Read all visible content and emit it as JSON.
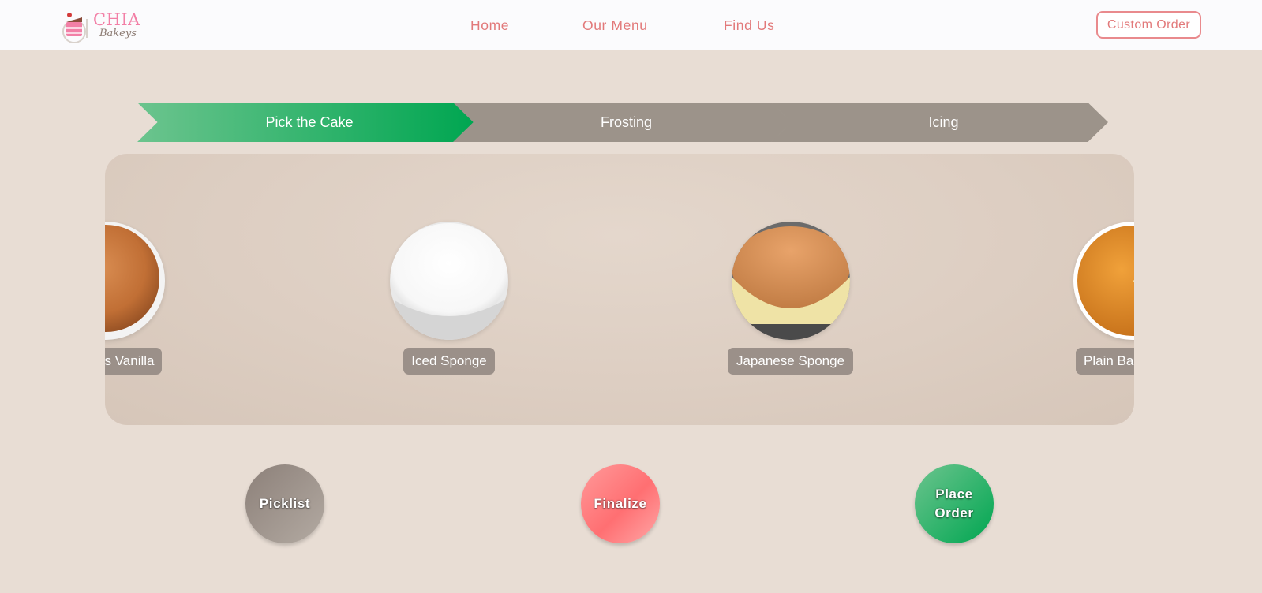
{
  "brand": {
    "name": "CHIA",
    "tagline": "Bakeys"
  },
  "nav": {
    "home": "Home",
    "menu": "Our Menu",
    "find_us": "Find Us"
  },
  "custom_order": "Custom Order",
  "steps": [
    "Pick the Cake",
    "Frosting",
    "Icing"
  ],
  "cakes": [
    "s Vanilla",
    "Iced Sponge",
    "Japanese Sponge",
    "Plain Ba"
  ],
  "actions": {
    "picklist": "Picklist",
    "finalize": "Finalize",
    "place_order": "Place Order"
  },
  "colors": {
    "accent_green": "#00a651",
    "accent_pink": "#e2797a",
    "step_inactive": "#9c938a",
    "background": "#e8ddd4"
  }
}
